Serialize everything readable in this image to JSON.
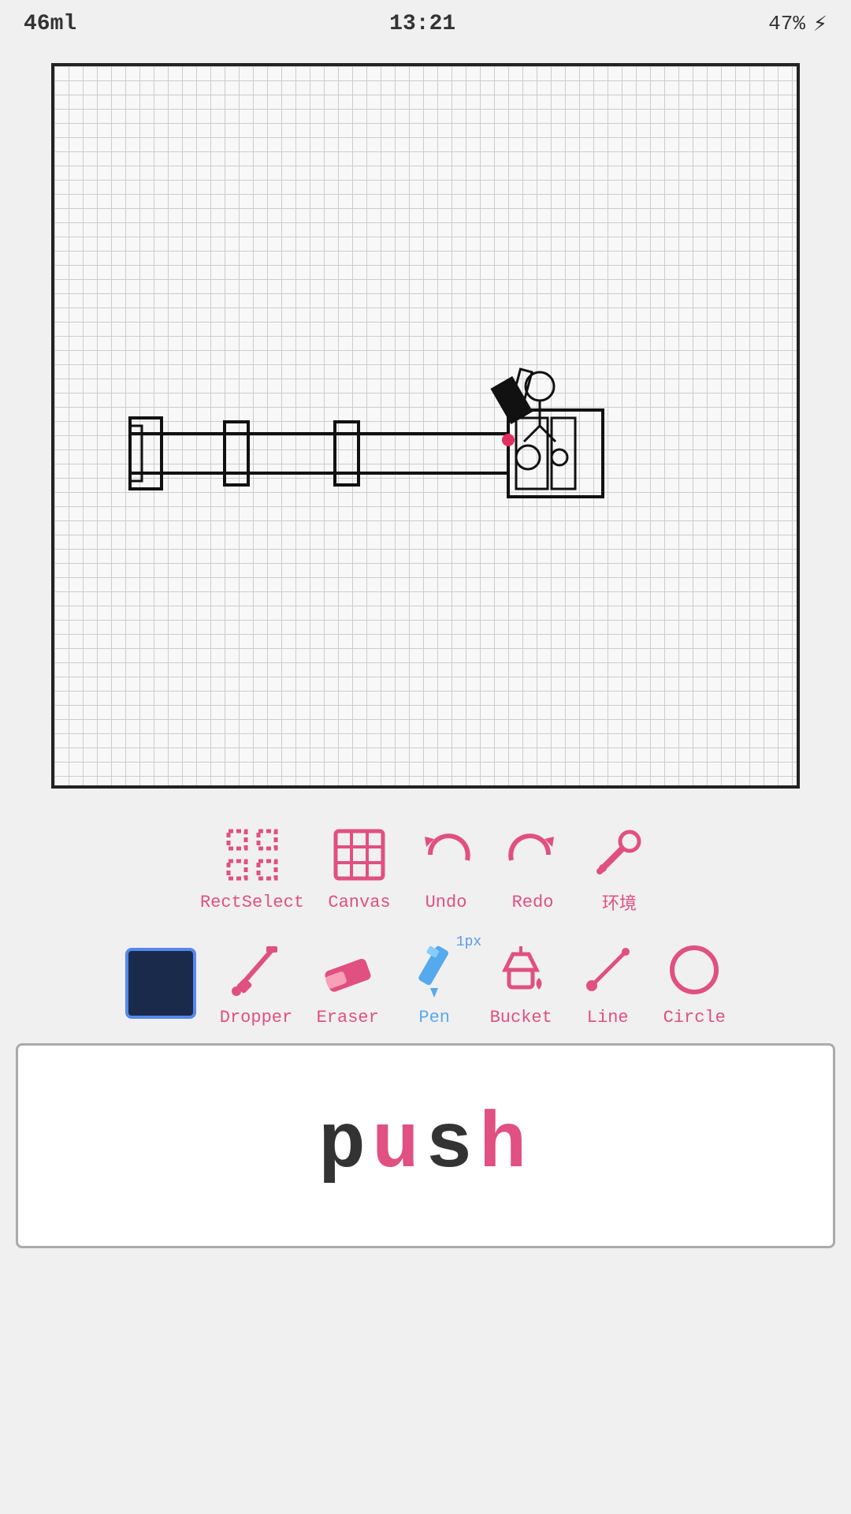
{
  "status": {
    "left": "46ml",
    "center": "13:21",
    "right": "47%",
    "battery_icon": "⚡"
  },
  "toolbar1": {
    "items": [
      {
        "id": "rect-select",
        "label": "RectSelect"
      },
      {
        "id": "canvas",
        "label": "Canvas"
      },
      {
        "id": "undo",
        "label": "Undo"
      },
      {
        "id": "redo",
        "label": "Redo"
      },
      {
        "id": "settings",
        "label": "环境"
      }
    ]
  },
  "toolbar2": {
    "items": [
      {
        "id": "color-swatch",
        "label": ""
      },
      {
        "id": "dropper",
        "label": "Dropper"
      },
      {
        "id": "eraser",
        "label": "Eraser"
      },
      {
        "id": "pen",
        "label": "Pen",
        "badge": "1px"
      },
      {
        "id": "bucket",
        "label": "Bucket"
      },
      {
        "id": "line",
        "label": "Line"
      },
      {
        "id": "circle",
        "label": "Circle"
      }
    ]
  },
  "bottom": {
    "logo": "push"
  }
}
